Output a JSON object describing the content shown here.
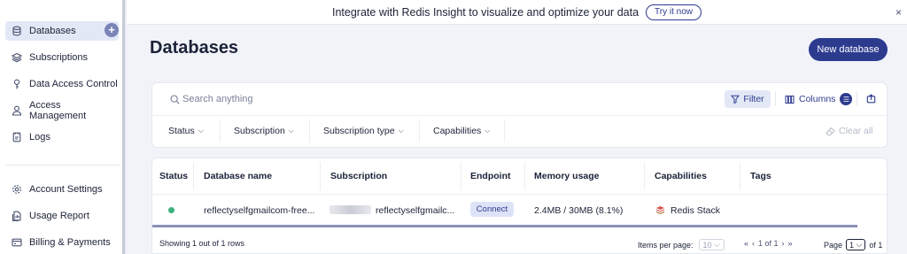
{
  "sidebar": {
    "items": [
      {
        "label": "Databases",
        "icon": "database-icon"
      },
      {
        "label": "Subscriptions",
        "icon": "layers-icon"
      },
      {
        "label": "Data Access Control",
        "icon": "key-icon"
      },
      {
        "label": "Access Management",
        "icon": "user-icon"
      },
      {
        "label": "Logs",
        "icon": "document-icon"
      }
    ],
    "bottom_items": [
      {
        "label": "Account Settings",
        "icon": "gear-icon"
      },
      {
        "label": "Usage Report",
        "icon": "report-icon"
      },
      {
        "label": "Billing & Payments",
        "icon": "credit-card-icon"
      }
    ],
    "add_label": "+"
  },
  "banner": {
    "text": "Integrate with Redis Insight to visualize and optimize your data",
    "button_label": "Try it now",
    "close_label": "×"
  },
  "header": {
    "title": "Databases",
    "new_button_label": "New database"
  },
  "filters": {
    "search_placeholder": "Search anything",
    "filter_label": "Filter",
    "columns_label": "Columns",
    "dropdowns": [
      "Status",
      "Subscription",
      "Subscription type",
      "Capabilities"
    ],
    "clear_all_label": "Clear all"
  },
  "table": {
    "headers": [
      "Status",
      "Database name",
      "Subscription",
      "Endpoint",
      "Memory usage",
      "Capabilities",
      "Tags"
    ],
    "rows": [
      {
        "status": "active",
        "database_name": "reflectyselfgmailcom-free...",
        "subscription": "reflectyselfgmailc...",
        "endpoint_label": "Connect",
        "memory_usage": "2.4MB / 30MB (8.1%)",
        "capabilities": "Redis Stack",
        "tags": ""
      }
    ],
    "footer": {
      "showing_text": "Showing 1 out of 1 rows",
      "items_per_page_label": "Items per page:",
      "items_per_page_value": "10",
      "pager_text": "1 of 1",
      "page_label": "Page",
      "page_value": "1",
      "of_text": "of 1"
    }
  },
  "colors": {
    "brand": "#2d3b8f",
    "status_active": "#3eb17e",
    "active_nav_bg": "#e3e8f7"
  }
}
